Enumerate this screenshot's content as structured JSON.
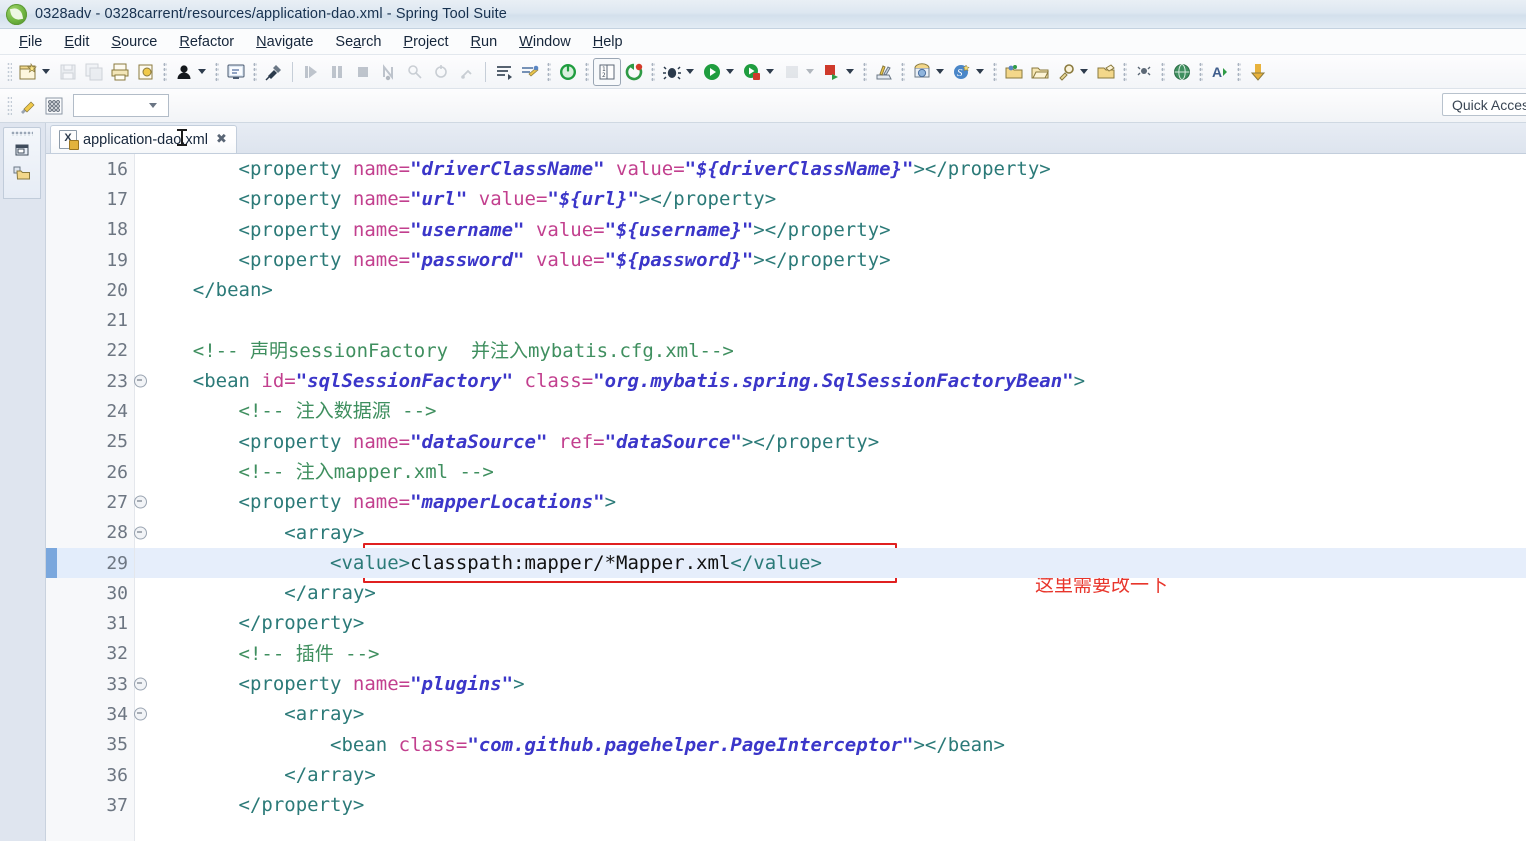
{
  "window": {
    "title": "0328adv - 0328carrent/resources/application-dao.xml - Spring Tool Suite",
    "logo_icon": "spring-leaf-logo-icon"
  },
  "menu": {
    "items": [
      {
        "label": "File",
        "mnemonic": "F"
      },
      {
        "label": "Edit",
        "mnemonic": "E"
      },
      {
        "label": "Source",
        "mnemonic": "S"
      },
      {
        "label": "Refactor",
        "mnemonic": "R"
      },
      {
        "label": "Navigate",
        "mnemonic": "N"
      },
      {
        "label": "Search",
        "mnemonic": "a"
      },
      {
        "label": "Project",
        "mnemonic": "P"
      },
      {
        "label": "Run",
        "mnemonic": "R"
      },
      {
        "label": "Window",
        "mnemonic": "W"
      },
      {
        "label": "Help",
        "mnemonic": "H"
      }
    ]
  },
  "toolbar": {
    "buttons": [
      {
        "name": "new-wizard-icon"
      },
      {
        "name": "new-wizard-dropdown-icon"
      },
      {
        "name": "save-icon"
      },
      {
        "name": "save-all-icon"
      },
      {
        "name": "print-icon"
      },
      {
        "name": "export-icon"
      },
      {
        "name": "user-icon"
      },
      {
        "name": "user-dropdown-icon"
      },
      {
        "name": "console-icon"
      },
      {
        "name": "toggle-breakpoint-icon"
      },
      {
        "name": "run-last-tool-icon"
      },
      {
        "name": "step-over-icon"
      },
      {
        "name": "terminate-icon"
      },
      {
        "name": "step-into-icon"
      },
      {
        "name": "skip-breakpoints-icon"
      },
      {
        "name": "disconnect-icon"
      },
      {
        "name": "resume-icon"
      },
      {
        "name": "outline-icon"
      },
      {
        "name": "spring-explorer-icon"
      },
      {
        "name": "boot-dashboard-icon"
      },
      {
        "name": "properties-view-icon"
      },
      {
        "name": "refresh-icon"
      },
      {
        "name": "debug-icon"
      },
      {
        "name": "debug-dropdown-icon"
      },
      {
        "name": "run-icon"
      },
      {
        "name": "run-dropdown-icon"
      },
      {
        "name": "run-server-icon"
      },
      {
        "name": "run-server-dropdown-icon"
      },
      {
        "name": "coverage-icon"
      },
      {
        "name": "coverage-dropdown-icon"
      },
      {
        "name": "stop-icon"
      },
      {
        "name": "stop-dropdown-icon"
      },
      {
        "name": "external-tools-icon"
      },
      {
        "name": "git-repo-icon"
      },
      {
        "name": "git-repo-dropdown-icon"
      },
      {
        "name": "spring-bean-icon"
      },
      {
        "name": "spring-bean-dropdown-icon"
      },
      {
        "name": "open-type-icon"
      },
      {
        "name": "open-resource-icon"
      },
      {
        "name": "search-icon"
      },
      {
        "name": "search-dropdown-icon"
      },
      {
        "name": "open-task-icon"
      },
      {
        "name": "pin-icon"
      },
      {
        "name": "web-browser-icon"
      },
      {
        "name": "next-annotation-icon"
      },
      {
        "name": "previous-annotation-icon"
      }
    ],
    "row2": [
      {
        "name": "quick-fix-icon"
      },
      {
        "name": "grid-icon"
      }
    ],
    "perspective_combo_value": "",
    "quick_access_placeholder": "Quick Access"
  },
  "left_fast_view": {
    "items": [
      {
        "name": "restore-view-icon"
      },
      {
        "name": "package-explorer-icon"
      }
    ]
  },
  "editor": {
    "tab": {
      "label": "application-dao.xml",
      "icon": "xml-file-icon",
      "close_label": "✖"
    },
    "current_line": 29,
    "first_line": 16,
    "annotation": {
      "text": "这里需要改一下",
      "color": "#e8352b",
      "box_color": "#e02020"
    },
    "lines": [
      {
        "num": 16,
        "fold": false,
        "tokens": [
          {
            "t": "tg",
            "s": "        <property "
          },
          {
            "t": "at",
            "s": "name="
          },
          {
            "t": "vl",
            "s": "\"driverClassName\""
          },
          {
            "t": "at",
            "s": " value="
          },
          {
            "t": "vl",
            "s": "\"${driverClassName}\""
          },
          {
            "t": "tg",
            "s": "></property>"
          }
        ]
      },
      {
        "num": 17,
        "fold": false,
        "tokens": [
          {
            "t": "tg",
            "s": "        <property "
          },
          {
            "t": "at",
            "s": "name="
          },
          {
            "t": "vl",
            "s": "\"url\""
          },
          {
            "t": "at",
            "s": " value="
          },
          {
            "t": "vl",
            "s": "\"${url}\""
          },
          {
            "t": "tg",
            "s": "></property>"
          }
        ]
      },
      {
        "num": 18,
        "fold": false,
        "tokens": [
          {
            "t": "tg",
            "s": "        <property "
          },
          {
            "t": "at",
            "s": "name="
          },
          {
            "t": "vl",
            "s": "\"username\""
          },
          {
            "t": "at",
            "s": " value="
          },
          {
            "t": "vl",
            "s": "\"${username}\""
          },
          {
            "t": "tg",
            "s": "></property>"
          }
        ]
      },
      {
        "num": 19,
        "fold": false,
        "tokens": [
          {
            "t": "tg",
            "s": "        <property "
          },
          {
            "t": "at",
            "s": "name="
          },
          {
            "t": "vl",
            "s": "\"password\""
          },
          {
            "t": "at",
            "s": " value="
          },
          {
            "t": "vl",
            "s": "\"${password}\""
          },
          {
            "t": "tg",
            "s": "></property>"
          }
        ]
      },
      {
        "num": 20,
        "fold": false,
        "tokens": [
          {
            "t": "tg",
            "s": "    </bean>"
          }
        ]
      },
      {
        "num": 21,
        "fold": false,
        "tokens": [
          {
            "t": "tx",
            "s": ""
          }
        ]
      },
      {
        "num": 22,
        "fold": false,
        "tokens": [
          {
            "t": "cm",
            "s": "    <!-- 声明sessionFactory  并注入mybatis.cfg.xml-->"
          }
        ]
      },
      {
        "num": 23,
        "fold": true,
        "tokens": [
          {
            "t": "tg",
            "s": "    <bean "
          },
          {
            "t": "at",
            "s": "id="
          },
          {
            "t": "vl",
            "s": "\"sqlSessionFactory\""
          },
          {
            "t": "at",
            "s": " class="
          },
          {
            "t": "vl",
            "s": "\"org.mybatis.spring.SqlSessionFactoryBean\""
          },
          {
            "t": "tg",
            "s": ">"
          }
        ]
      },
      {
        "num": 24,
        "fold": false,
        "tokens": [
          {
            "t": "cm",
            "s": "        <!-- 注入数据源 -->"
          }
        ]
      },
      {
        "num": 25,
        "fold": false,
        "tokens": [
          {
            "t": "tg",
            "s": "        <property "
          },
          {
            "t": "at",
            "s": "name="
          },
          {
            "t": "vl",
            "s": "\"dataSource\""
          },
          {
            "t": "at",
            "s": " ref="
          },
          {
            "t": "vl",
            "s": "\"dataSource\""
          },
          {
            "t": "tg",
            "s": "></property>"
          }
        ]
      },
      {
        "num": 26,
        "fold": false,
        "tokens": [
          {
            "t": "cm",
            "s": "        <!-- 注入mapper.xml -->"
          }
        ]
      },
      {
        "num": 27,
        "fold": true,
        "tokens": [
          {
            "t": "tg",
            "s": "        <property "
          },
          {
            "t": "at",
            "s": "name="
          },
          {
            "t": "vl",
            "s": "\"mapperLocations\""
          },
          {
            "t": "tg",
            "s": ">"
          }
        ]
      },
      {
        "num": 28,
        "fold": true,
        "tokens": [
          {
            "t": "tg",
            "s": "            <array>"
          }
        ]
      },
      {
        "num": 29,
        "fold": false,
        "current": true,
        "tokens": [
          {
            "t": "tg",
            "s": "                <value>"
          },
          {
            "t": "tx",
            "s": "classpath:mapper/*Mapper.xml"
          },
          {
            "t": "tg",
            "s": "</value>"
          }
        ]
      },
      {
        "num": 30,
        "fold": false,
        "tokens": [
          {
            "t": "tg",
            "s": "            </array>"
          }
        ]
      },
      {
        "num": 31,
        "fold": false,
        "tokens": [
          {
            "t": "tg",
            "s": "        </property>"
          }
        ]
      },
      {
        "num": 32,
        "fold": false,
        "tokens": [
          {
            "t": "cm",
            "s": "        <!-- 插件 -->"
          }
        ]
      },
      {
        "num": 33,
        "fold": true,
        "tokens": [
          {
            "t": "tg",
            "s": "        <property "
          },
          {
            "t": "at",
            "s": "name="
          },
          {
            "t": "vl",
            "s": "\"plugins\""
          },
          {
            "t": "tg",
            "s": ">"
          }
        ]
      },
      {
        "num": 34,
        "fold": true,
        "tokens": [
          {
            "t": "tg",
            "s": "            <array>"
          }
        ]
      },
      {
        "num": 35,
        "fold": false,
        "tokens": [
          {
            "t": "tg",
            "s": "                <bean "
          },
          {
            "t": "at",
            "s": "class="
          },
          {
            "t": "vl",
            "s": "\"com.github.pagehelper.PageInterceptor\""
          },
          {
            "t": "tg",
            "s": "></bean>"
          }
        ]
      },
      {
        "num": 36,
        "fold": false,
        "tokens": [
          {
            "t": "tg",
            "s": "            </array>"
          }
        ]
      },
      {
        "num": 37,
        "fold": false,
        "tokens": [
          {
            "t": "tg",
            "s": "        </property>"
          }
        ]
      }
    ]
  }
}
